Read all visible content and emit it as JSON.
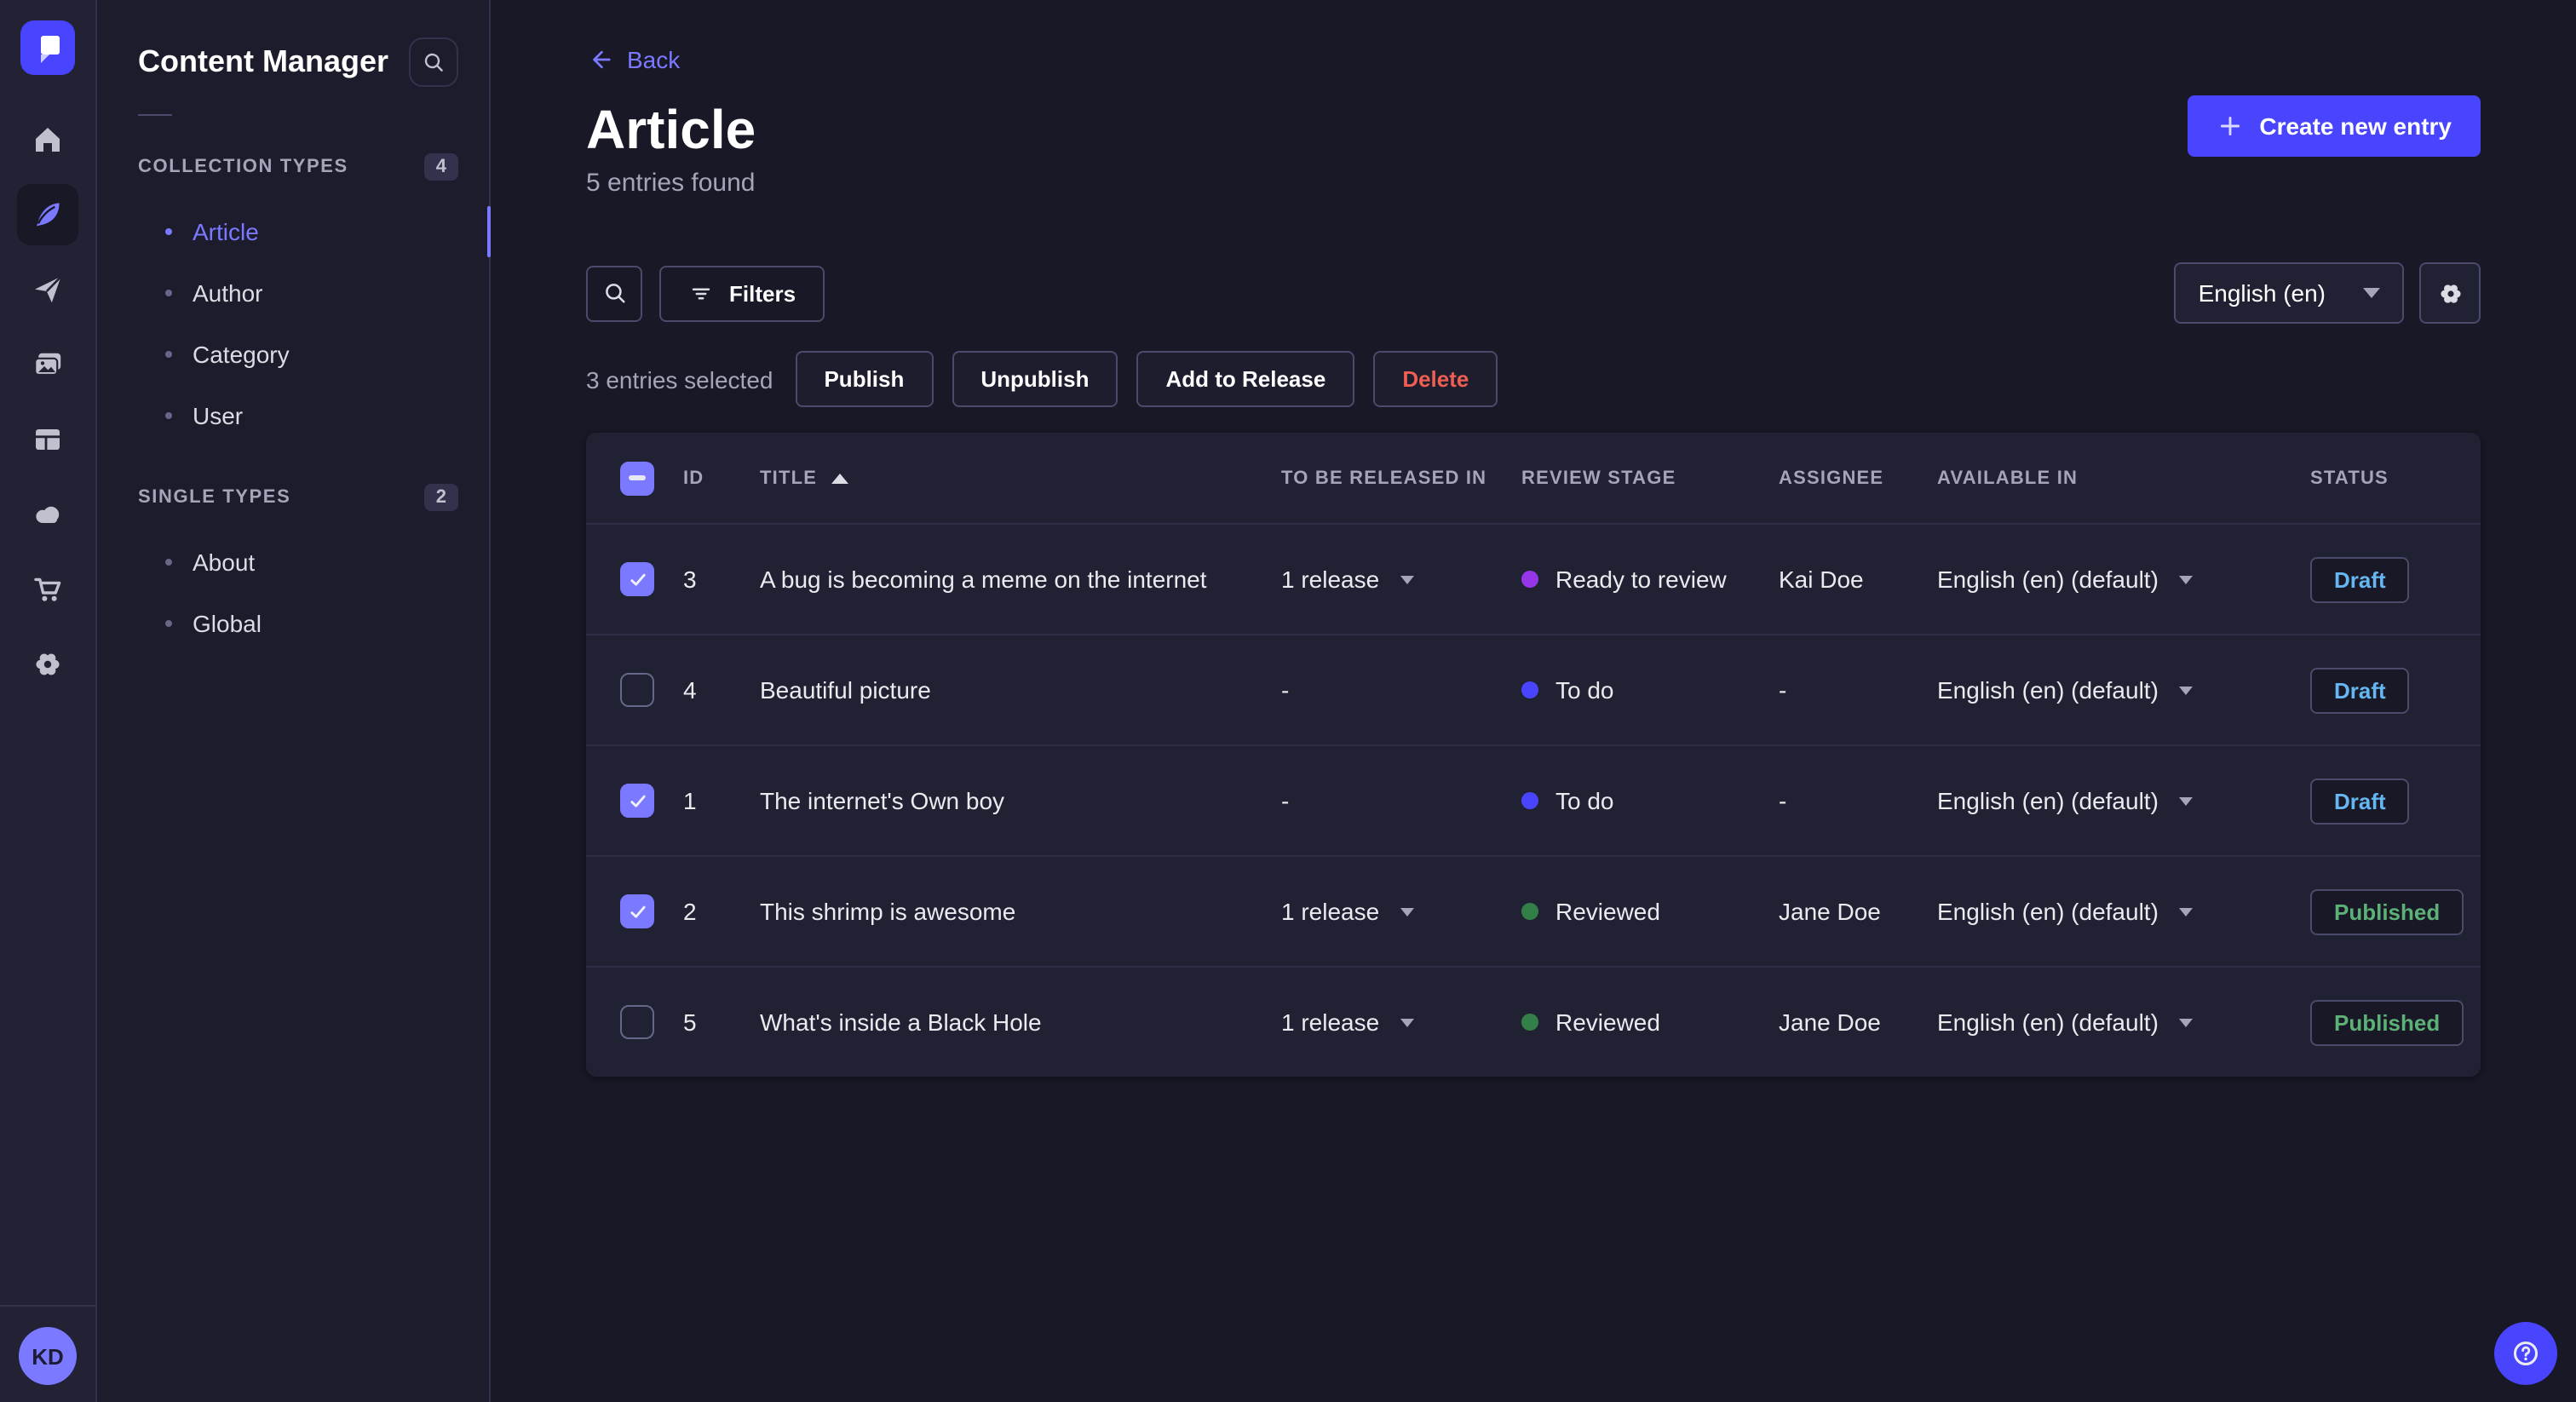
{
  "rail": {
    "icons": [
      "home",
      "content-manager",
      "send",
      "media-library",
      "content-type-builder",
      "cloud",
      "marketplace",
      "settings"
    ],
    "avatar_initials": "KD"
  },
  "subnav": {
    "title": "Content Manager",
    "sections": [
      {
        "label": "COLLECTION TYPES",
        "count": "4",
        "items": [
          {
            "label": "Article"
          },
          {
            "label": "Author"
          },
          {
            "label": "Category"
          },
          {
            "label": "User"
          }
        ]
      },
      {
        "label": "SINGLE TYPES",
        "count": "2",
        "items": [
          {
            "label": "About"
          },
          {
            "label": "Global"
          }
        ]
      }
    ]
  },
  "header": {
    "back_label": "Back",
    "title": "Article",
    "subtitle": "5 entries found",
    "create_label": "Create new entry"
  },
  "toolbar": {
    "filters_label": "Filters",
    "locale_label": "English (en)"
  },
  "selection": {
    "text": "3 entries selected",
    "publish_label": "Publish",
    "unpublish_label": "Unpublish",
    "add_to_release_label": "Add to Release",
    "delete_label": "Delete"
  },
  "table": {
    "columns": {
      "id": "ID",
      "title": "TITLE",
      "released": "TO BE RELEASED IN",
      "review": "REVIEW STAGE",
      "assignee": "ASSIGNEE",
      "available": "AVAILABLE IN",
      "status": "STATUS"
    },
    "rows": [
      {
        "selected": true,
        "id": "3",
        "title": "A bug is becoming a meme on the internet",
        "released": "1 release",
        "review": "Ready to review",
        "assignee": "Kai Doe",
        "available": "English (en) (default)",
        "status": "Draft"
      },
      {
        "selected": false,
        "id": "4",
        "title": "Beautiful picture",
        "released": "-",
        "review": "To do",
        "assignee": "-",
        "available": "English (en) (default)",
        "status": "Draft"
      },
      {
        "selected": true,
        "id": "1",
        "title": "The internet's Own boy",
        "released": "-",
        "review": "To do",
        "assignee": "-",
        "available": "English (en) (default)",
        "status": "Draft"
      },
      {
        "selected": true,
        "id": "2",
        "title": "This shrimp is awesome",
        "released": "1 release",
        "review": "Reviewed",
        "assignee": "Jane Doe",
        "available": "English (en) (default)",
        "status": "Published"
      },
      {
        "selected": false,
        "id": "5",
        "title": "What's inside a Black Hole",
        "released": "1 release",
        "review": "Reviewed",
        "assignee": "Jane Doe",
        "available": "English (en) (default)",
        "status": "Published"
      }
    ]
  },
  "colors": {
    "primary": "#4945ff",
    "primary_light": "#7b79ff",
    "draft_text": "#66b7f1",
    "published_text": "#5cb176",
    "ready_to_review_dot": "#9736e8",
    "todo_dot": "#4945ff",
    "reviewed_dot": "#328048",
    "danger_text": "#ee5e52",
    "card_bg": "#212134",
    "page_bg": "#181826",
    "border": "#32324d"
  }
}
